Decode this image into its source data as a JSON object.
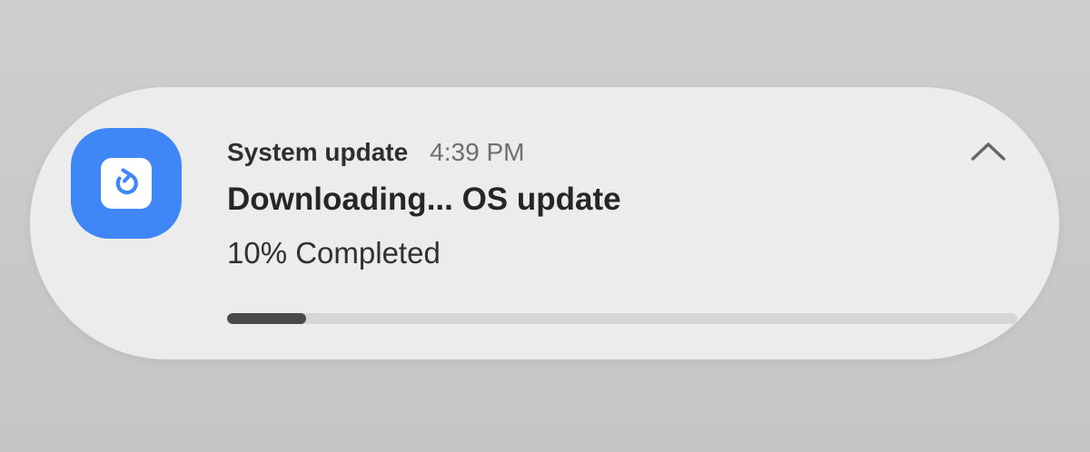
{
  "notification": {
    "app_icon": "system-update-icon",
    "accent_color": "#3f86f6",
    "app_name": "System update",
    "timestamp": "4:39 PM",
    "title": "Downloading... OS update",
    "status_text": "10% Completed",
    "progress_fraction": 0.1,
    "collapse_icon": "chevron-up-icon"
  }
}
